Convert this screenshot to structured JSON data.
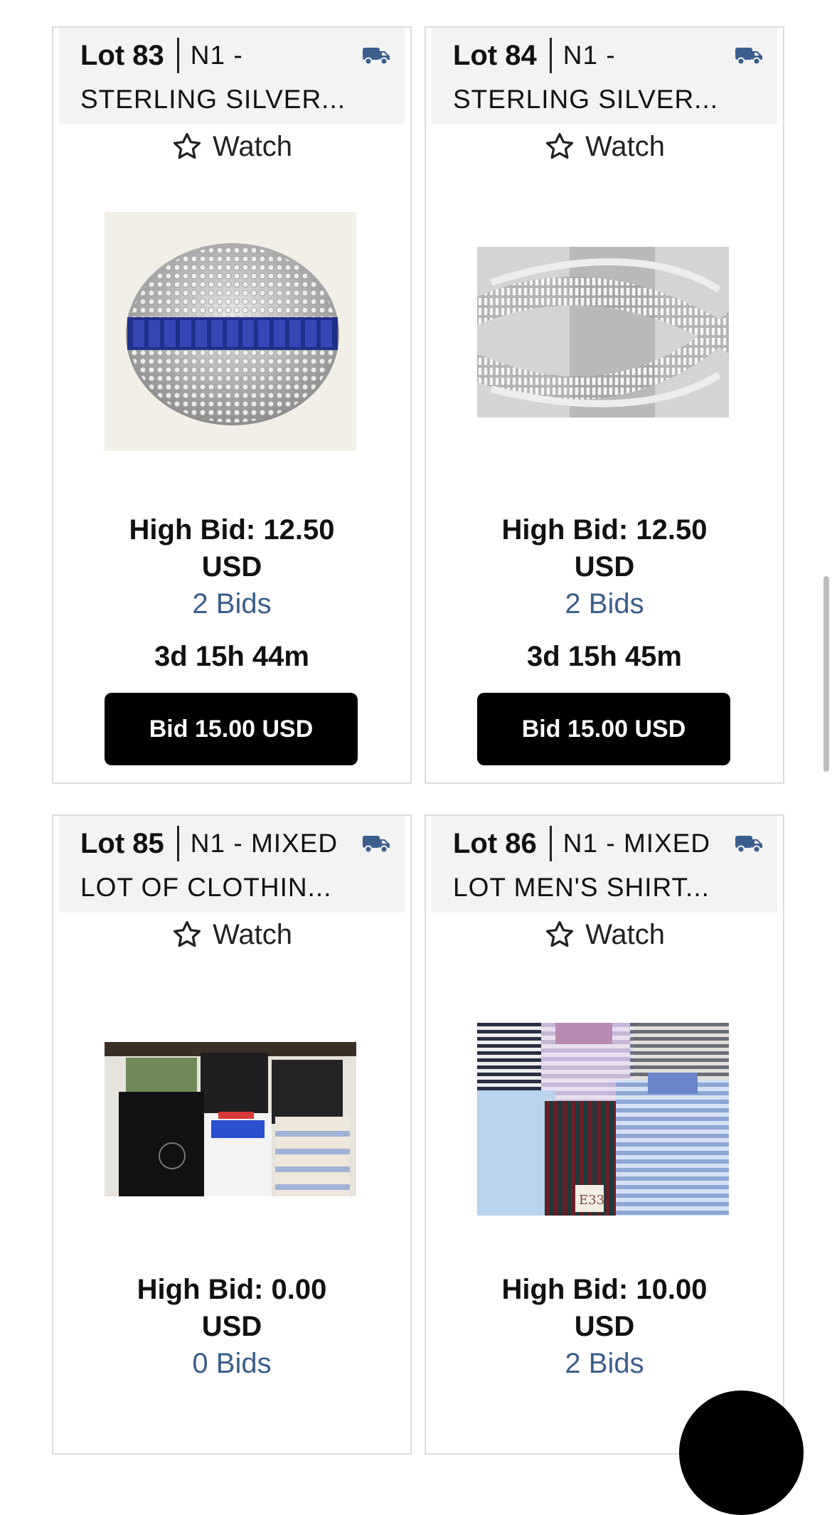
{
  "lots": [
    {
      "lot_label": "Lot 83",
      "title_line1": "N1 -",
      "title_line2": "STERLING SILVER...",
      "watch_label": "Watch",
      "high_bid_line1": "High Bid: 12.50",
      "high_bid_line2": "USD",
      "bids_count": "2 Bids",
      "time_left": "3d 15h 44m",
      "bid_button": "Bid 15.00 USD",
      "image_icon": "sapphire-diamond-ring-photo"
    },
    {
      "lot_label": "Lot 84",
      "title_line1": "N1 -",
      "title_line2": "STERLING SILVER...",
      "watch_label": "Watch",
      "high_bid_line1": "High Bid: 12.50",
      "high_bid_line2": "USD",
      "bids_count": "2 Bids",
      "time_left": "3d 15h 45m",
      "bid_button": "Bid 15.00 USD",
      "image_icon": "crossover-diamond-ring-photo"
    },
    {
      "lot_label": "Lot 85",
      "title_line1": "N1 - MIXED",
      "title_line2": "LOT OF CLOTHIN...",
      "watch_label": "Watch",
      "high_bid_line1": "High Bid: 0.00",
      "high_bid_line2": "USD",
      "bids_count": "0 Bids",
      "image_icon": "clothing-lot-photo"
    },
    {
      "lot_label": "Lot 86",
      "title_line1": "N1 - MIXED",
      "title_line2": "LOT MEN'S SHIRT...",
      "watch_label": "Watch",
      "high_bid_line1": "High Bid: 10.00",
      "high_bid_line2": "USD",
      "bids_count": "2 Bids",
      "image_icon": "mens-shirts-photo"
    }
  ],
  "colors": {
    "bids_link": "#3b5e8c",
    "truck_icon": "#3b5e8c",
    "bid_button_bg": "#000000",
    "header_bg": "#f3f3f3"
  }
}
